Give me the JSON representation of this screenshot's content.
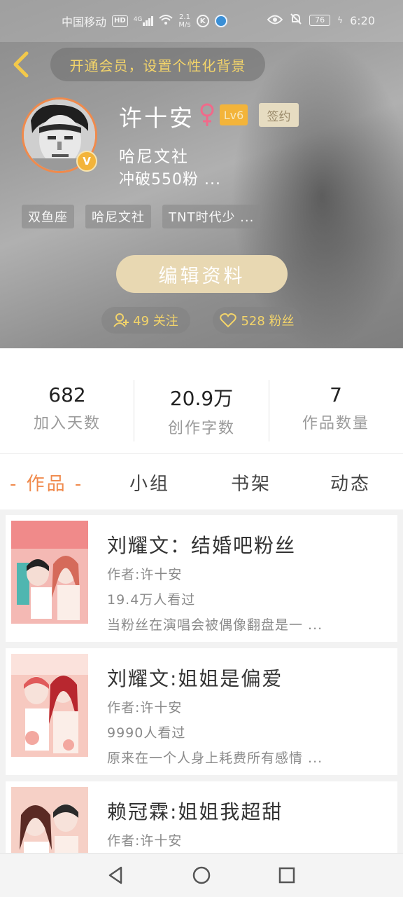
{
  "status_bar": {
    "carrier": "中国移动",
    "hd": "HD",
    "signal": "4G",
    "speed_value": "2.1",
    "speed_unit": "M/s",
    "battery": "76",
    "time": "6:20"
  },
  "header": {
    "vip_prompt": "开通会员，设置个性化背景"
  },
  "profile": {
    "username": "许十安",
    "level": "Lv6",
    "sign_badge": "签约",
    "organization": "哈尼文社",
    "bio": "冲破550粉 ...",
    "tags": [
      "双鱼座",
      "哈尼文社",
      "TNT时代少 ..."
    ],
    "edit_button": "编辑资料",
    "follow_label": "49 关注",
    "fans_label": "528 粉丝"
  },
  "stats": [
    {
      "value": "682",
      "label": "加入天数"
    },
    {
      "value": "20.9万",
      "label": "创作字数"
    },
    {
      "value": "7",
      "label": "作品数量"
    }
  ],
  "tabs": [
    "- 作品 -",
    "小组",
    "书架",
    "动态"
  ],
  "works": [
    {
      "title": "刘耀文：结婚吧粉丝",
      "author": "作者:许十安",
      "views": "19.4万人看过",
      "desc": "当粉丝在演唱会被偶像翻盘是一 ..."
    },
    {
      "title": "刘耀文:姐姐是偏爱",
      "author": "作者:许十安",
      "views": "9990人看过",
      "desc": "原来在一个人身上耗费所有感情 ..."
    },
    {
      "title": "赖冠霖:姐姐我超甜",
      "author": "作者:许十安",
      "views": "",
      "desc": ""
    }
  ],
  "colors": {
    "accent": "#f08a4c",
    "gold": "#f3d46a",
    "edit_button": "#e8d8b2"
  }
}
